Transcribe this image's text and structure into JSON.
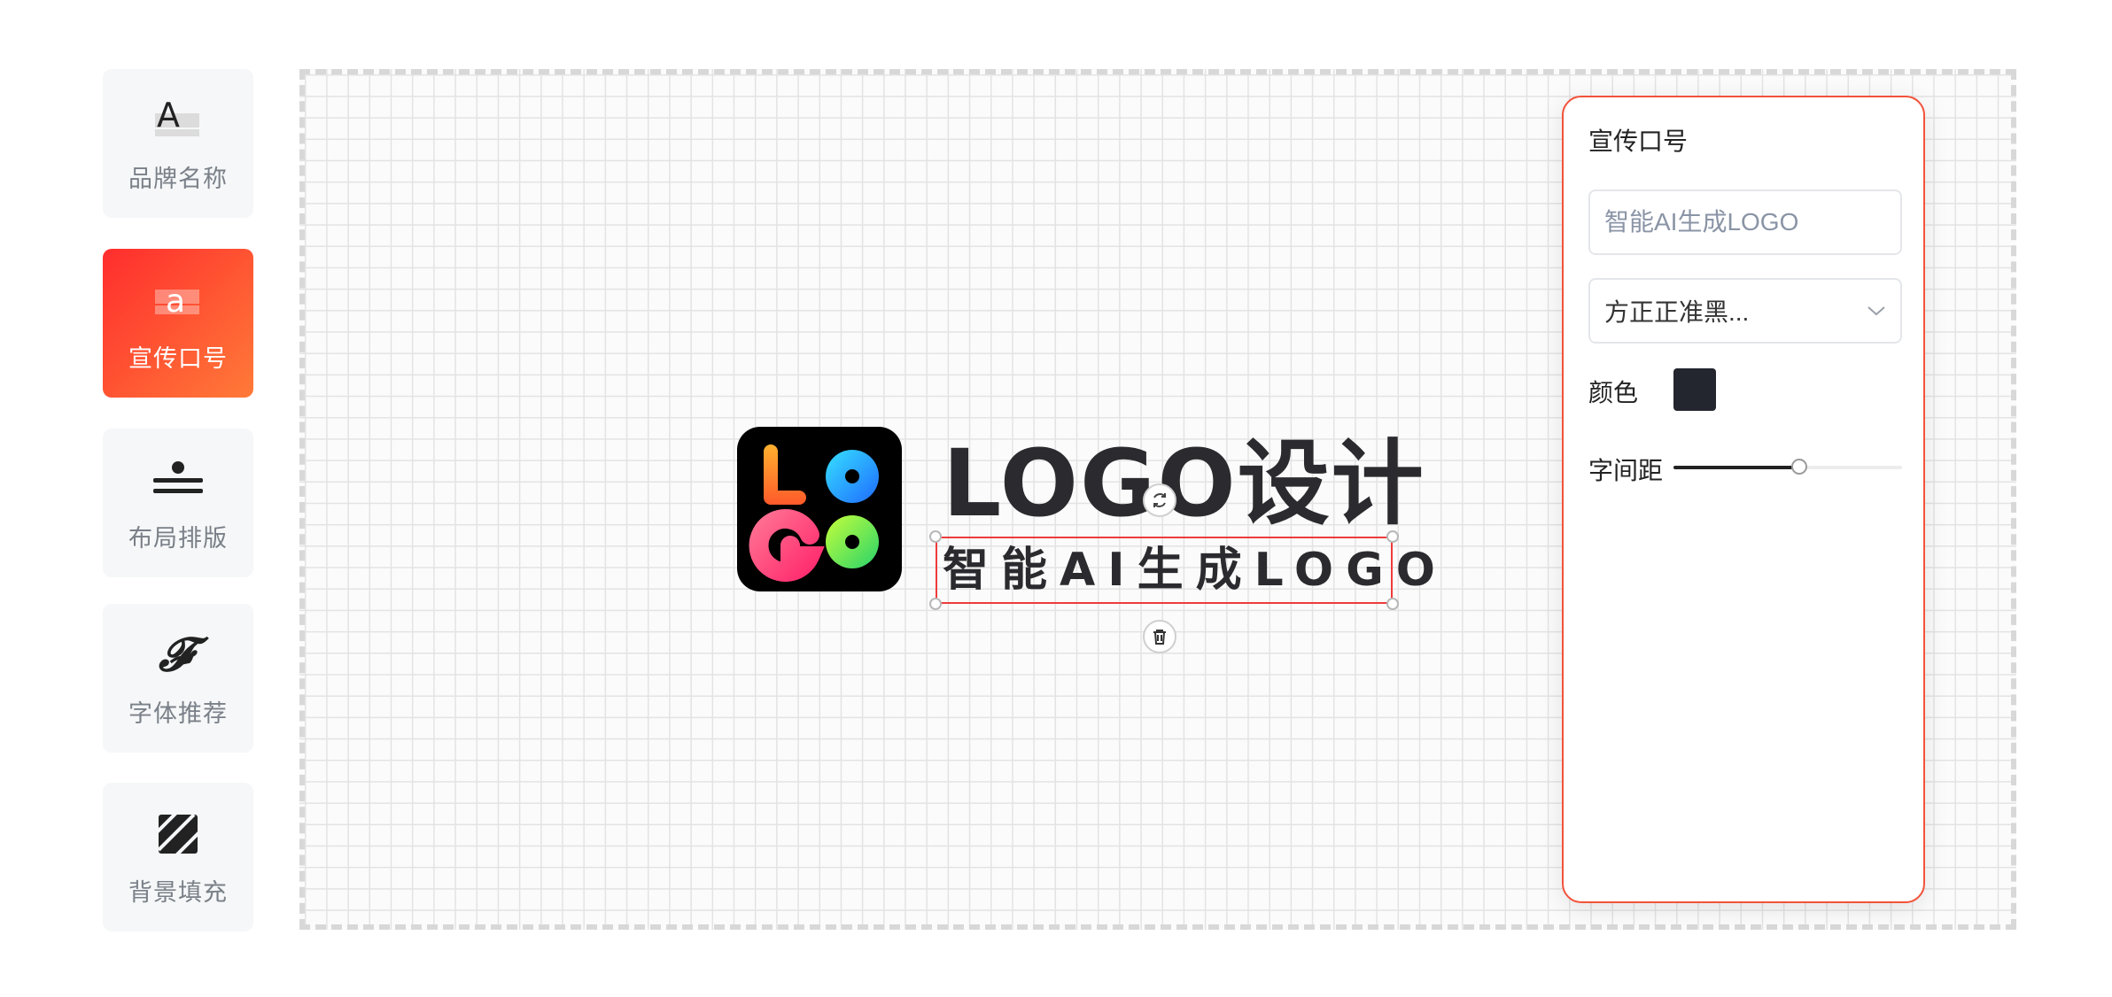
{
  "sidebar": {
    "items": [
      {
        "label": "品牌名称",
        "icon": "brand-name-icon",
        "icon_glyph": "A",
        "active": false
      },
      {
        "label": "宣传口号",
        "icon": "slogan-icon",
        "icon_glyph": "a",
        "active": true
      },
      {
        "label": "布局排版",
        "icon": "layout-icon",
        "active": false
      },
      {
        "label": "字体推荐",
        "icon": "font-icon",
        "icon_glyph": "𝓕",
        "active": false
      },
      {
        "label": "背景填充",
        "icon": "background-fill-icon",
        "active": false
      }
    ]
  },
  "canvas": {
    "logo_letters": [
      "L",
      "O",
      "G",
      "O"
    ],
    "brand_text": "LOGO设计",
    "slogan_text": "智能AI生成LOGO"
  },
  "panel": {
    "title": "宣传口号",
    "slogan_input": {
      "value": "",
      "placeholder": "智能AI生成LOGO"
    },
    "font_select": {
      "value": "方正正准黑..."
    },
    "color_label": "颜色",
    "color_value": "#23262f",
    "spacing_label": "字间距",
    "spacing_value": 0.55
  },
  "colors": {
    "accent": "#f2533a",
    "active_gradient_start": "#ff2d2d",
    "active_gradient_end": "#ff7a38"
  }
}
